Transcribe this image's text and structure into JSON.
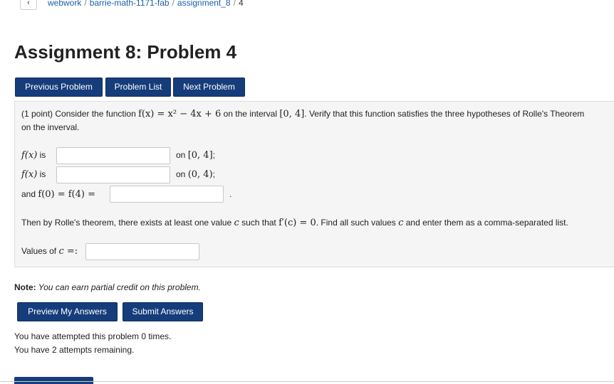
{
  "breadcrumb": {
    "back_glyph": "‹",
    "items": [
      "webwork",
      "barrie-math-1171-fab",
      "assignment_8",
      "4"
    ]
  },
  "page_title": "Assignment 8: Problem 4",
  "nav": {
    "previous": "Previous Problem",
    "list": "Problem List",
    "next": "Next Problem"
  },
  "problem": {
    "intro_prefix": "(1 point) Consider the function ",
    "intro_function": "f(x) = x² − 4x + 6",
    "intro_mid": " on the interval ",
    "intro_interval": "[0, 4]",
    "intro_suffix": ". Verify that this function satisfies the three hypotheses of Rolle's Theorem",
    "intro_line2": "on the inverval.",
    "row1": {
      "label_fx": "f(x)",
      "label_is": " is",
      "value": "",
      "on": "on ",
      "interval": "[0, 4]",
      "end": ";"
    },
    "row2": {
      "label_fx": "f(x)",
      "label_is": " is",
      "value": "",
      "on": "on ",
      "interval": "(0, 4)",
      "end": ";"
    },
    "row3": {
      "label_and": "and ",
      "label_eq": "f(0) = f(4) =",
      "value": "",
      "end": "."
    },
    "rolle_prefix": "Then by Rolle's theorem, there exists at least one value ",
    "rolle_c": "c",
    "rolle_mid": " such that ",
    "rolle_eq": "f′(c) = 0",
    "rolle_mid2": ". Find all such values ",
    "rolle_c2": "c",
    "rolle_suffix": " and enter them as a comma-separated list.",
    "values_prefix": "Values of ",
    "values_c": "c",
    "values_eq": " =:",
    "values_value": ""
  },
  "note": {
    "label": "Note:",
    "text": " You can earn partial credit on this problem."
  },
  "actions": {
    "preview": "Preview My Answers",
    "submit": "Submit Answers"
  },
  "attempts": {
    "line1": "You have attempted this problem 0 times.",
    "line2": "You have 2 attempts remaining."
  },
  "colors": {
    "button_bg": "#163d7b",
    "problem_bg": "#f5f5f5",
    "link": "#1a5fa8"
  }
}
